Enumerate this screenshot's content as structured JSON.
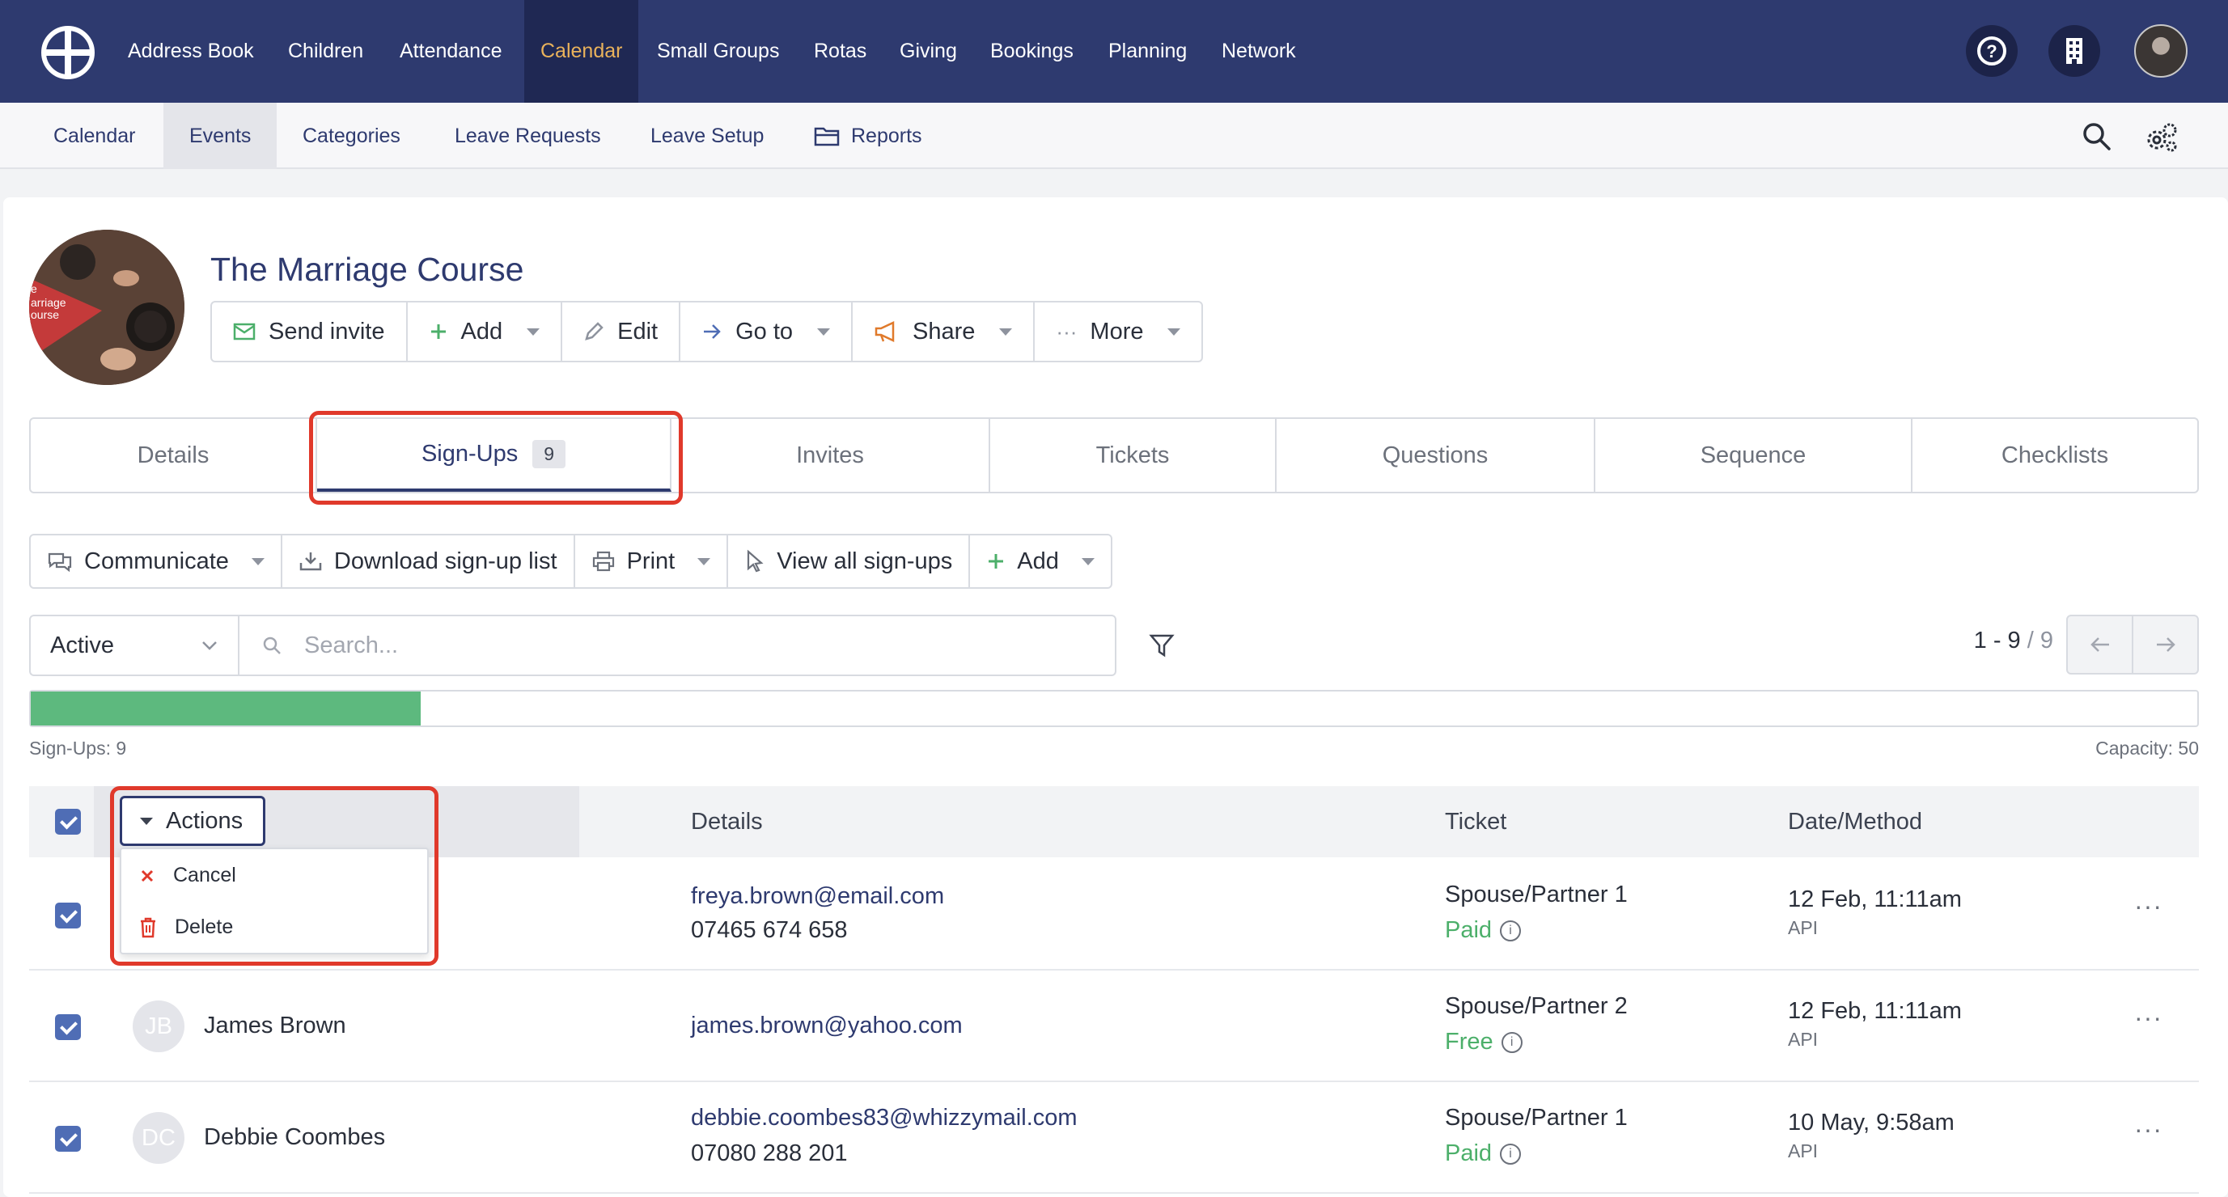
{
  "top_nav": {
    "items": [
      "Address Book",
      "Children",
      "Attendance",
      "Calendar",
      "Small Groups",
      "Rotas",
      "Giving",
      "Bookings",
      "Planning",
      "Network"
    ],
    "active": "Calendar"
  },
  "sub_nav": {
    "items": [
      "Calendar",
      "Events",
      "Categories",
      "Leave Requests",
      "Leave Setup",
      "Reports"
    ],
    "active": "Events"
  },
  "event": {
    "title": "The Marriage Course",
    "image_text": "e\narriage\nourse",
    "buttons": [
      "Send invite",
      "Add",
      "Edit",
      "Go to",
      "Share",
      "More"
    ]
  },
  "tabs": {
    "items": [
      "Details",
      "Sign-Ups",
      "Invites",
      "Tickets",
      "Questions",
      "Sequence",
      "Checklists"
    ],
    "active": "Sign-Ups",
    "signups_count": "9"
  },
  "toolbar": {
    "buttons": [
      "Communicate",
      "Download sign-up list",
      "Print",
      "View all sign-ups",
      "Add"
    ]
  },
  "filter": {
    "status": "Active",
    "search_placeholder": "Search...",
    "range": "1 - 9",
    "total": "/ 9"
  },
  "capacity": {
    "fill_fraction": 0.18,
    "signups_label": "Sign-Ups: 9",
    "capacity_label": "Capacity: 50"
  },
  "table": {
    "headers": [
      "Details",
      "Ticket",
      "Date/Method"
    ],
    "actions_label": "Actions",
    "actions_menu": [
      "Cancel",
      "Delete"
    ],
    "rows": [
      {
        "initials": "",
        "name": "",
        "email": "freya.brown@email.com",
        "phone": "07465 674 658",
        "ticket": "Spouse/Partner 1",
        "payment": "Paid",
        "date": "12 Feb, 11:11am",
        "method": "API"
      },
      {
        "initials": "JB",
        "name": "James Brown",
        "email": "james.brown@yahoo.com",
        "phone": "",
        "ticket": "Spouse/Partner 2",
        "payment": "Free",
        "date": "12 Feb, 11:11am",
        "method": "API"
      },
      {
        "initials": "DC",
        "name": "Debbie Coombes",
        "email": "debbie.coombes83@whizzymail.com",
        "phone": "07080 288 201",
        "ticket": "Spouse/Partner 1",
        "payment": "Paid",
        "date": "10 May, 9:58am",
        "method": "API"
      }
    ]
  },
  "colors": {
    "nav_bg": "#2e3a6f",
    "nav_active": "#e9b25b",
    "progress": "#5db97e",
    "highlight": "#e0392b",
    "paid": "#4caf6a"
  }
}
